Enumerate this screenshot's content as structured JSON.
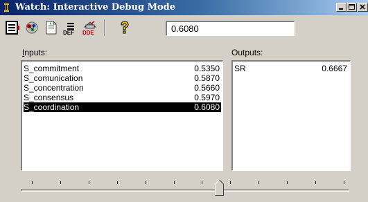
{
  "window": {
    "title": "Watch: Interactive Debug Mode"
  },
  "toolbar": {
    "icons": [
      "debug-window-icon",
      "connections-icon",
      "document-icon",
      "def-icon",
      "dde-icon",
      "help-icon"
    ],
    "def_label": "DEF",
    "dde_label": "DDE",
    "value": "0.6080"
  },
  "inputs": {
    "label": "Inputs:",
    "items": [
      {
        "name": "S_commitment",
        "value": "0.5350"
      },
      {
        "name": "S_comunication",
        "value": "0.5870"
      },
      {
        "name": "S_concentration",
        "value": "0.5660"
      },
      {
        "name": "S_consensus",
        "value": "0.5970"
      },
      {
        "name": "S_coordination",
        "value": "0.6080"
      }
    ],
    "selected_index": 4
  },
  "outputs": {
    "label": "Outputs:",
    "items": [
      {
        "name": "SR",
        "value": "0.6667"
      }
    ]
  },
  "slider": {
    "tick_count": 12,
    "position_fraction": 0.6
  }
}
